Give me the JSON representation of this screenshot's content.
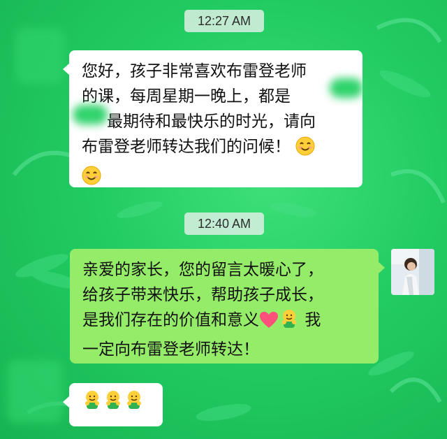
{
  "chat": {
    "time_1": "12:27 AM",
    "time_2": "12:40 AM",
    "message_1": {
      "lines": [
        "您好，孩子非常喜欢布雷登老师",
        "的课，每周星期一晚上，都是",
        "最期待和最快乐的时光，请向",
        "布雷登老师转达我们的问候！"
      ],
      "emoji": "smiling-face-icon"
    },
    "message_2": {
      "lines": [
        "亲爱的家长，您的留言太暖心了，",
        "给孩子带来快乐，帮助孩子成长，",
        "是我们存在的价值和意义",
        "我",
        "一定向布雷登老师转达！"
      ],
      "emoji": [
        "heart-icon",
        "hug-icon"
      ]
    },
    "message_3": {
      "emoji": [
        "hug-icon",
        "hug-icon",
        "hug-icon"
      ]
    }
  },
  "colors": {
    "background": "#22cc62",
    "incoming_bubble": "#ffffff",
    "outgoing_bubble": "#95ec69",
    "heart": "#ff4f7b",
    "emoji_yellow": "#ffcf3a"
  }
}
